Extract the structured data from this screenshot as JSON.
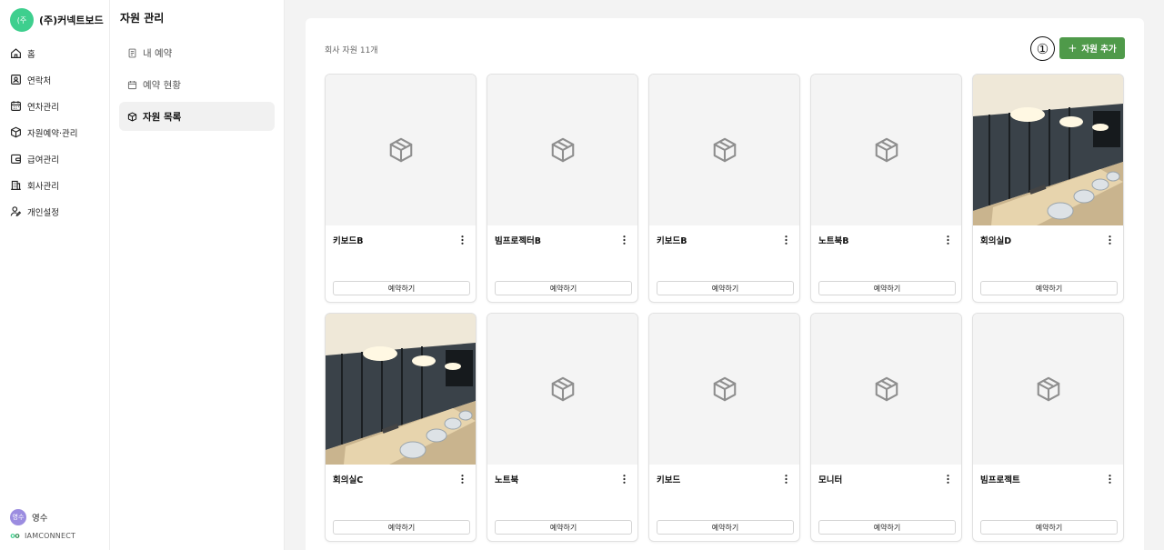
{
  "brand": {
    "logo_text": "(주",
    "name": "(주)커넥트보드"
  },
  "nav": {
    "items": [
      {
        "label": "홈"
      },
      {
        "label": "연락처"
      },
      {
        "label": "연차관리"
      },
      {
        "label": "자원예약·관리"
      },
      {
        "label": "급여관리"
      },
      {
        "label": "회사관리"
      },
      {
        "label": "개인설정"
      }
    ],
    "user": {
      "avatar_text": "영수",
      "name": "영수"
    },
    "footer": "IAMCONNECT"
  },
  "subnav": {
    "title": "자원 관리",
    "items": [
      {
        "label": "내 예약"
      },
      {
        "label": "예약 현황"
      },
      {
        "label": "자원 목록"
      }
    ]
  },
  "main": {
    "count_text": "회사 자원 11개",
    "step_marker": "①",
    "add_button": "자원 추가",
    "reserve_label": "예약하기",
    "resources": [
      {
        "name": "키보드B"
      },
      {
        "name": "빔프로젝터B"
      },
      {
        "name": "키보드B"
      },
      {
        "name": "노트북B"
      },
      {
        "name": "회의실D"
      },
      {
        "name": "회의실C"
      },
      {
        "name": "노트북"
      },
      {
        "name": "키보드"
      },
      {
        "name": "모니터"
      },
      {
        "name": "빔프로젝트"
      }
    ]
  },
  "colors": {
    "brand": "#3ecf8e",
    "accent": "#4f9a4a",
    "avatar": "#9b8ce0"
  }
}
